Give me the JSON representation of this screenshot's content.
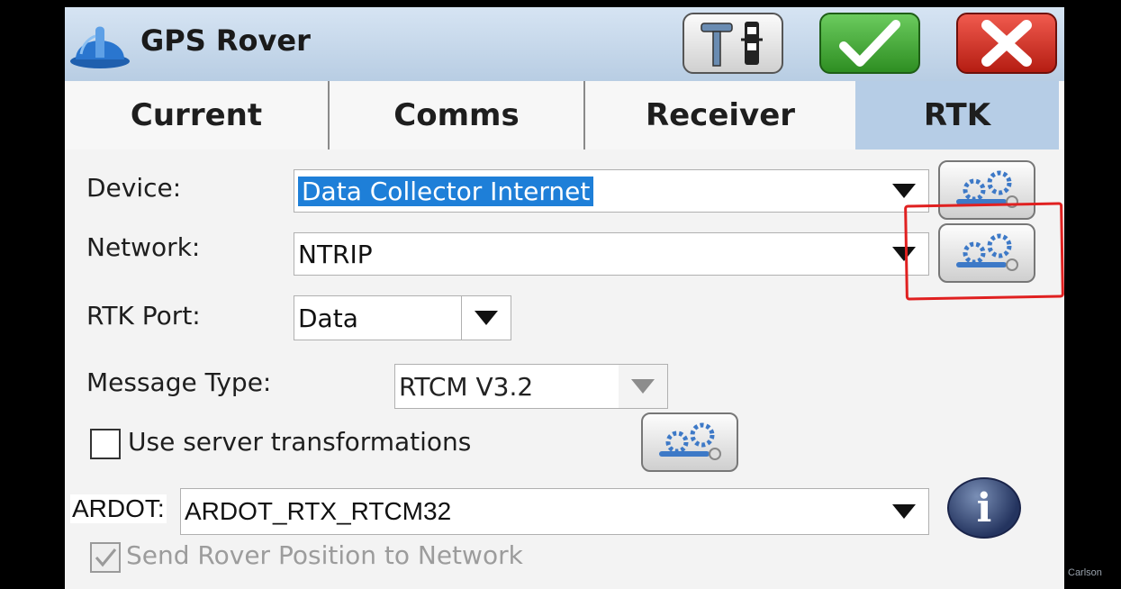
{
  "window": {
    "title": "GPS Rover"
  },
  "tabs": [
    {
      "label": "Current"
    },
    {
      "label": "Comms"
    },
    {
      "label": "Receiver"
    },
    {
      "label": "RTK"
    }
  ],
  "form": {
    "device": {
      "label": "Device:",
      "value": "Data Collector Internet"
    },
    "network": {
      "label": "Network:",
      "value": "NTRIP"
    },
    "rtk_port": {
      "label": "RTK Port:",
      "value": "Data"
    },
    "message_type": {
      "label": "Message Type:",
      "value": "RTCM V3.2"
    },
    "use_server_transformations": {
      "label": "Use server transformations",
      "checked": false
    },
    "mountpoint": {
      "label": "ARDOT:",
      "value": "ARDOT_RTX_RTCM32"
    },
    "send_rover_position": {
      "label": "Send Rover Position to Network",
      "checked": true,
      "enabled": false
    }
  },
  "icons": {
    "app": "hard-hat-icon",
    "rover": "rover-pole-icon",
    "ok": "checkmark-icon",
    "cancel": "close-icon",
    "settings": "gears-wrench-icon",
    "info": "info-icon"
  },
  "colors": {
    "selected_highlight": "#1e7fd8",
    "active_tab": "#b6cde6",
    "ok_green": "#2e8e22",
    "cancel_red": "#b51d12",
    "annotation_red": "#e02020"
  },
  "watermark": "Carlson"
}
